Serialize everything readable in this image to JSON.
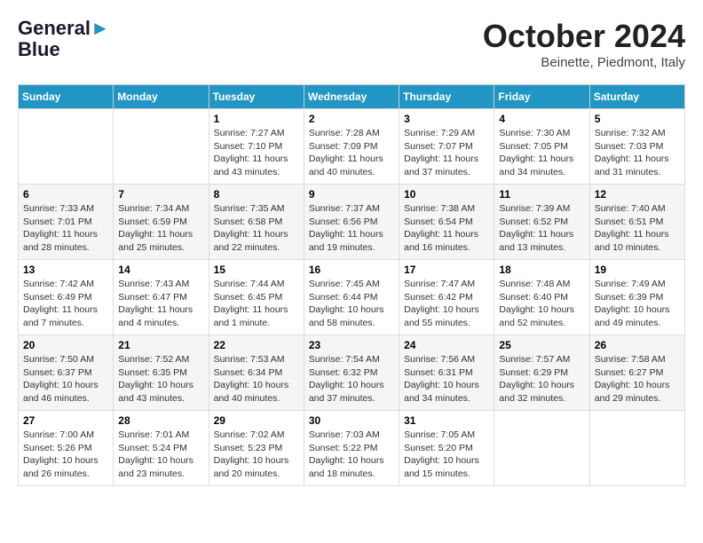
{
  "logo": {
    "line1": "General",
    "line2": "Blue"
  },
  "title": "October 2024",
  "location": "Beinette, Piedmont, Italy",
  "weekdays": [
    "Sunday",
    "Monday",
    "Tuesday",
    "Wednesday",
    "Thursday",
    "Friday",
    "Saturday"
  ],
  "weeks": [
    [
      {
        "day": "",
        "info": ""
      },
      {
        "day": "",
        "info": ""
      },
      {
        "day": "1",
        "info": "Sunrise: 7:27 AM\nSunset: 7:10 PM\nDaylight: 11 hours and 43 minutes."
      },
      {
        "day": "2",
        "info": "Sunrise: 7:28 AM\nSunset: 7:09 PM\nDaylight: 11 hours and 40 minutes."
      },
      {
        "day": "3",
        "info": "Sunrise: 7:29 AM\nSunset: 7:07 PM\nDaylight: 11 hours and 37 minutes."
      },
      {
        "day": "4",
        "info": "Sunrise: 7:30 AM\nSunset: 7:05 PM\nDaylight: 11 hours and 34 minutes."
      },
      {
        "day": "5",
        "info": "Sunrise: 7:32 AM\nSunset: 7:03 PM\nDaylight: 11 hours and 31 minutes."
      }
    ],
    [
      {
        "day": "6",
        "info": "Sunrise: 7:33 AM\nSunset: 7:01 PM\nDaylight: 11 hours and 28 minutes."
      },
      {
        "day": "7",
        "info": "Sunrise: 7:34 AM\nSunset: 6:59 PM\nDaylight: 11 hours and 25 minutes."
      },
      {
        "day": "8",
        "info": "Sunrise: 7:35 AM\nSunset: 6:58 PM\nDaylight: 11 hours and 22 minutes."
      },
      {
        "day": "9",
        "info": "Sunrise: 7:37 AM\nSunset: 6:56 PM\nDaylight: 11 hours and 19 minutes."
      },
      {
        "day": "10",
        "info": "Sunrise: 7:38 AM\nSunset: 6:54 PM\nDaylight: 11 hours and 16 minutes."
      },
      {
        "day": "11",
        "info": "Sunrise: 7:39 AM\nSunset: 6:52 PM\nDaylight: 11 hours and 13 minutes."
      },
      {
        "day": "12",
        "info": "Sunrise: 7:40 AM\nSunset: 6:51 PM\nDaylight: 11 hours and 10 minutes."
      }
    ],
    [
      {
        "day": "13",
        "info": "Sunrise: 7:42 AM\nSunset: 6:49 PM\nDaylight: 11 hours and 7 minutes."
      },
      {
        "day": "14",
        "info": "Sunrise: 7:43 AM\nSunset: 6:47 PM\nDaylight: 11 hours and 4 minutes."
      },
      {
        "day": "15",
        "info": "Sunrise: 7:44 AM\nSunset: 6:45 PM\nDaylight: 11 hours and 1 minute."
      },
      {
        "day": "16",
        "info": "Sunrise: 7:45 AM\nSunset: 6:44 PM\nDaylight: 10 hours and 58 minutes."
      },
      {
        "day": "17",
        "info": "Sunrise: 7:47 AM\nSunset: 6:42 PM\nDaylight: 10 hours and 55 minutes."
      },
      {
        "day": "18",
        "info": "Sunrise: 7:48 AM\nSunset: 6:40 PM\nDaylight: 10 hours and 52 minutes."
      },
      {
        "day": "19",
        "info": "Sunrise: 7:49 AM\nSunset: 6:39 PM\nDaylight: 10 hours and 49 minutes."
      }
    ],
    [
      {
        "day": "20",
        "info": "Sunrise: 7:50 AM\nSunset: 6:37 PM\nDaylight: 10 hours and 46 minutes."
      },
      {
        "day": "21",
        "info": "Sunrise: 7:52 AM\nSunset: 6:35 PM\nDaylight: 10 hours and 43 minutes."
      },
      {
        "day": "22",
        "info": "Sunrise: 7:53 AM\nSunset: 6:34 PM\nDaylight: 10 hours and 40 minutes."
      },
      {
        "day": "23",
        "info": "Sunrise: 7:54 AM\nSunset: 6:32 PM\nDaylight: 10 hours and 37 minutes."
      },
      {
        "day": "24",
        "info": "Sunrise: 7:56 AM\nSunset: 6:31 PM\nDaylight: 10 hours and 34 minutes."
      },
      {
        "day": "25",
        "info": "Sunrise: 7:57 AM\nSunset: 6:29 PM\nDaylight: 10 hours and 32 minutes."
      },
      {
        "day": "26",
        "info": "Sunrise: 7:58 AM\nSunset: 6:27 PM\nDaylight: 10 hours and 29 minutes."
      }
    ],
    [
      {
        "day": "27",
        "info": "Sunrise: 7:00 AM\nSunset: 5:26 PM\nDaylight: 10 hours and 26 minutes."
      },
      {
        "day": "28",
        "info": "Sunrise: 7:01 AM\nSunset: 5:24 PM\nDaylight: 10 hours and 23 minutes."
      },
      {
        "day": "29",
        "info": "Sunrise: 7:02 AM\nSunset: 5:23 PM\nDaylight: 10 hours and 20 minutes."
      },
      {
        "day": "30",
        "info": "Sunrise: 7:03 AM\nSunset: 5:22 PM\nDaylight: 10 hours and 18 minutes."
      },
      {
        "day": "31",
        "info": "Sunrise: 7:05 AM\nSunset: 5:20 PM\nDaylight: 10 hours and 15 minutes."
      },
      {
        "day": "",
        "info": ""
      },
      {
        "day": "",
        "info": ""
      }
    ]
  ]
}
